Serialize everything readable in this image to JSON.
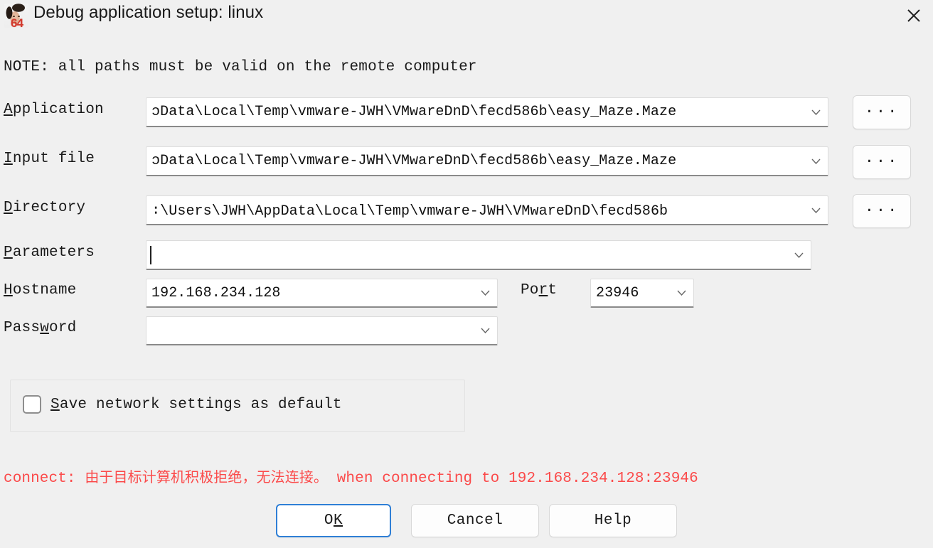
{
  "window": {
    "title": "Debug application setup: linux",
    "icon": "ida64-icon",
    "close_label": "×",
    "background_color": "#f0f0f0"
  },
  "note": "NOTE: all paths must be valid on the remote computer",
  "fields": {
    "application": {
      "label_pre": "A",
      "label_post": "pplication",
      "value": "ɔData\\Local\\Temp\\vmware-JWH\\VMwareDnD\\fecd586b\\easy_Maze.Maze",
      "browse_label": "...",
      "dropdown_icon": "chevron-down-icon"
    },
    "input_file": {
      "label_pre": "I",
      "label_post": "nput file",
      "value": "ɔData\\Local\\Temp\\vmware-JWH\\VMwareDnD\\fecd586b\\easy_Maze.Maze",
      "browse_label": "...",
      "dropdown_icon": "chevron-down-icon"
    },
    "directory": {
      "label_pre": "D",
      "label_post": "irectory",
      "value": "∶\\Users\\JWH\\AppData\\Local\\Temp\\vmware-JWH\\VMwareDnD\\fecd586b",
      "browse_label": "...",
      "dropdown_icon": "chevron-down-icon"
    },
    "parameters": {
      "label_pre": "P",
      "label_post": "arameters",
      "value": "",
      "dropdown_icon": "chevron-down-icon"
    },
    "hostname": {
      "label_pre": "H",
      "label_post": "ostname",
      "value": "192.168.234.128",
      "dropdown_icon": "chevron-down-icon"
    },
    "port": {
      "label_pre": "Po",
      "label_mid": "r",
      "label_post": "t",
      "value": "23946",
      "dropdown_icon": "chevron-down-icon"
    },
    "password": {
      "label_pre": "Pass",
      "label_mid": "w",
      "label_post": "ord",
      "value": "",
      "dropdown_icon": "chevron-down-icon"
    }
  },
  "save_settings": {
    "label_pre": "S",
    "label_post": "ave network settings as default",
    "checked": false
  },
  "error": {
    "prefix": "connect: ",
    "message_cn": "由于目标计算机积极拒绝，无法连接。",
    "suffix": " when connecting to 192.168.234.128:23946",
    "color": "#fb4a4a"
  },
  "buttons": {
    "ok_pre": "O",
    "ok_key": "K",
    "cancel": "Cancel",
    "help": "Help",
    "focus_color": "#2f7fd6"
  }
}
